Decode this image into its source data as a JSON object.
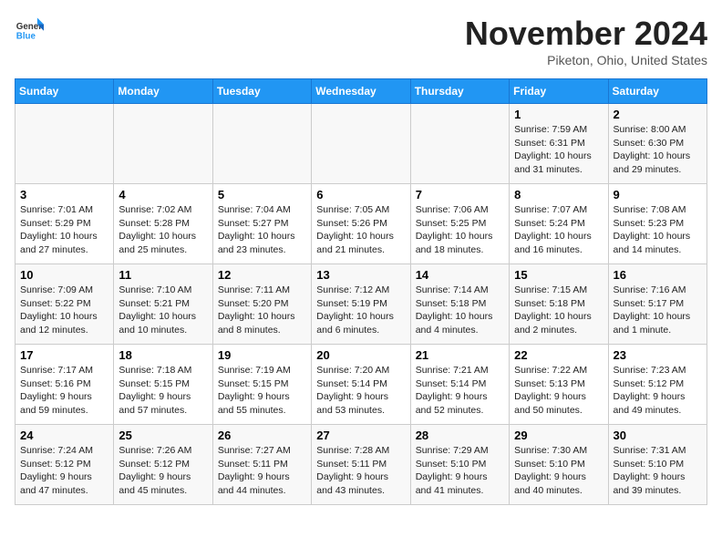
{
  "header": {
    "logo_general": "General",
    "logo_blue": "Blue",
    "month": "November 2024",
    "location": "Piketon, Ohio, United States"
  },
  "days_of_week": [
    "Sunday",
    "Monday",
    "Tuesday",
    "Wednesday",
    "Thursday",
    "Friday",
    "Saturday"
  ],
  "weeks": [
    [
      {
        "day": "",
        "info": ""
      },
      {
        "day": "",
        "info": ""
      },
      {
        "day": "",
        "info": ""
      },
      {
        "day": "",
        "info": ""
      },
      {
        "day": "",
        "info": ""
      },
      {
        "day": "1",
        "info": "Sunrise: 7:59 AM\nSunset: 6:31 PM\nDaylight: 10 hours and 31 minutes."
      },
      {
        "day": "2",
        "info": "Sunrise: 8:00 AM\nSunset: 6:30 PM\nDaylight: 10 hours and 29 minutes."
      }
    ],
    [
      {
        "day": "3",
        "info": "Sunrise: 7:01 AM\nSunset: 5:29 PM\nDaylight: 10 hours and 27 minutes."
      },
      {
        "day": "4",
        "info": "Sunrise: 7:02 AM\nSunset: 5:28 PM\nDaylight: 10 hours and 25 minutes."
      },
      {
        "day": "5",
        "info": "Sunrise: 7:04 AM\nSunset: 5:27 PM\nDaylight: 10 hours and 23 minutes."
      },
      {
        "day": "6",
        "info": "Sunrise: 7:05 AM\nSunset: 5:26 PM\nDaylight: 10 hours and 21 minutes."
      },
      {
        "day": "7",
        "info": "Sunrise: 7:06 AM\nSunset: 5:25 PM\nDaylight: 10 hours and 18 minutes."
      },
      {
        "day": "8",
        "info": "Sunrise: 7:07 AM\nSunset: 5:24 PM\nDaylight: 10 hours and 16 minutes."
      },
      {
        "day": "9",
        "info": "Sunrise: 7:08 AM\nSunset: 5:23 PM\nDaylight: 10 hours and 14 minutes."
      }
    ],
    [
      {
        "day": "10",
        "info": "Sunrise: 7:09 AM\nSunset: 5:22 PM\nDaylight: 10 hours and 12 minutes."
      },
      {
        "day": "11",
        "info": "Sunrise: 7:10 AM\nSunset: 5:21 PM\nDaylight: 10 hours and 10 minutes."
      },
      {
        "day": "12",
        "info": "Sunrise: 7:11 AM\nSunset: 5:20 PM\nDaylight: 10 hours and 8 minutes."
      },
      {
        "day": "13",
        "info": "Sunrise: 7:12 AM\nSunset: 5:19 PM\nDaylight: 10 hours and 6 minutes."
      },
      {
        "day": "14",
        "info": "Sunrise: 7:14 AM\nSunset: 5:18 PM\nDaylight: 10 hours and 4 minutes."
      },
      {
        "day": "15",
        "info": "Sunrise: 7:15 AM\nSunset: 5:18 PM\nDaylight: 10 hours and 2 minutes."
      },
      {
        "day": "16",
        "info": "Sunrise: 7:16 AM\nSunset: 5:17 PM\nDaylight: 10 hours and 1 minute."
      }
    ],
    [
      {
        "day": "17",
        "info": "Sunrise: 7:17 AM\nSunset: 5:16 PM\nDaylight: 9 hours and 59 minutes."
      },
      {
        "day": "18",
        "info": "Sunrise: 7:18 AM\nSunset: 5:15 PM\nDaylight: 9 hours and 57 minutes."
      },
      {
        "day": "19",
        "info": "Sunrise: 7:19 AM\nSunset: 5:15 PM\nDaylight: 9 hours and 55 minutes."
      },
      {
        "day": "20",
        "info": "Sunrise: 7:20 AM\nSunset: 5:14 PM\nDaylight: 9 hours and 53 minutes."
      },
      {
        "day": "21",
        "info": "Sunrise: 7:21 AM\nSunset: 5:14 PM\nDaylight: 9 hours and 52 minutes."
      },
      {
        "day": "22",
        "info": "Sunrise: 7:22 AM\nSunset: 5:13 PM\nDaylight: 9 hours and 50 minutes."
      },
      {
        "day": "23",
        "info": "Sunrise: 7:23 AM\nSunset: 5:12 PM\nDaylight: 9 hours and 49 minutes."
      }
    ],
    [
      {
        "day": "24",
        "info": "Sunrise: 7:24 AM\nSunset: 5:12 PM\nDaylight: 9 hours and 47 minutes."
      },
      {
        "day": "25",
        "info": "Sunrise: 7:26 AM\nSunset: 5:12 PM\nDaylight: 9 hours and 45 minutes."
      },
      {
        "day": "26",
        "info": "Sunrise: 7:27 AM\nSunset: 5:11 PM\nDaylight: 9 hours and 44 minutes."
      },
      {
        "day": "27",
        "info": "Sunrise: 7:28 AM\nSunset: 5:11 PM\nDaylight: 9 hours and 43 minutes."
      },
      {
        "day": "28",
        "info": "Sunrise: 7:29 AM\nSunset: 5:10 PM\nDaylight: 9 hours and 41 minutes."
      },
      {
        "day": "29",
        "info": "Sunrise: 7:30 AM\nSunset: 5:10 PM\nDaylight: 9 hours and 40 minutes."
      },
      {
        "day": "30",
        "info": "Sunrise: 7:31 AM\nSunset: 5:10 PM\nDaylight: 9 hours and 39 minutes."
      }
    ]
  ]
}
